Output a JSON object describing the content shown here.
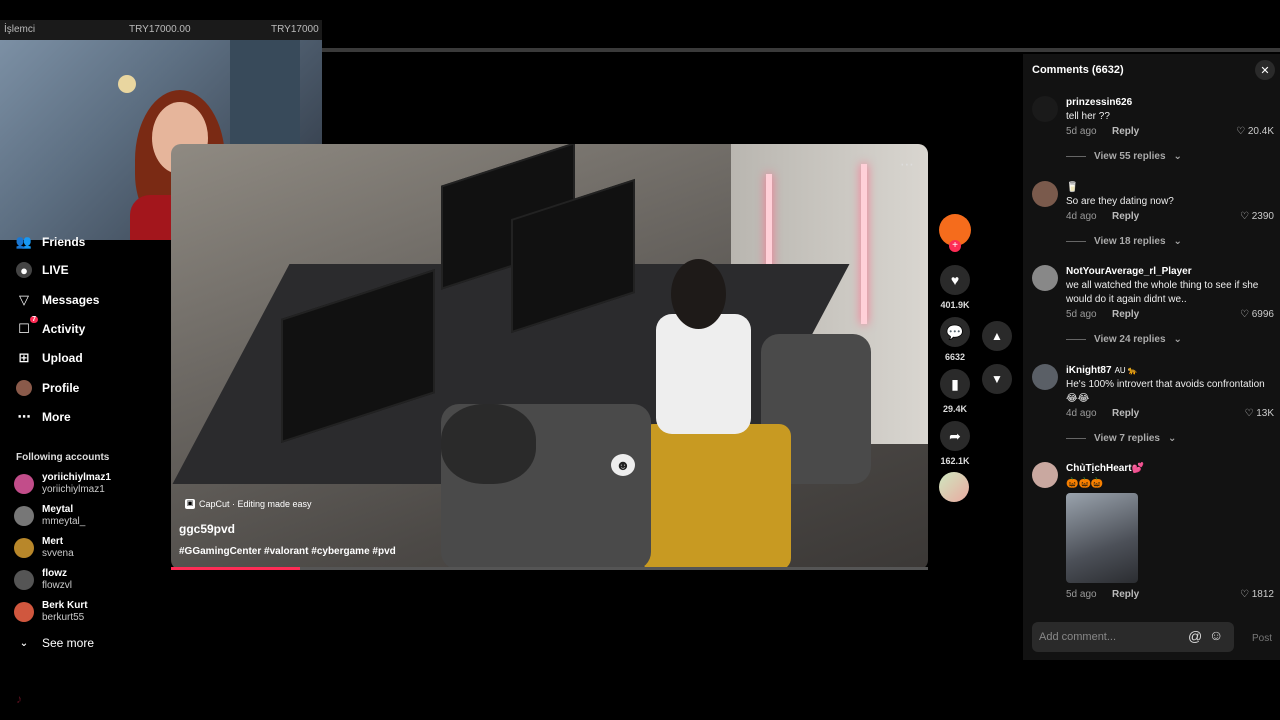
{
  "webcam": {
    "label_left": "İşlemci",
    "label_mid": "TRY17000.00",
    "label_right": "TRY17000"
  },
  "sidebar": {
    "items": [
      {
        "label": "Friends",
        "icon": "friends-icon"
      },
      {
        "label": "LIVE",
        "icon": "live-icon"
      },
      {
        "label": "Messages",
        "icon": "messages-icon"
      },
      {
        "label": "Activity",
        "icon": "activity-icon",
        "badge": "7"
      },
      {
        "label": "Upload",
        "icon": "upload-icon"
      },
      {
        "label": "Profile",
        "icon": "profile-icon"
      },
      {
        "label": "More",
        "icon": "more-icon"
      }
    ],
    "following_title": "Following accounts",
    "accounts": [
      {
        "name": "yoriichiylmaz1",
        "handle": "yoriichiylmaz1"
      },
      {
        "name": "Meytal",
        "handle": "mmeytal_"
      },
      {
        "name": "Mert",
        "handle": "svvena"
      },
      {
        "name": "flowz",
        "handle": "flowzvl"
      },
      {
        "name": "Berk Kurt",
        "handle": "berkurt55"
      }
    ],
    "see_more": "See more"
  },
  "video": {
    "capcut": "CapCut · Editing made easy",
    "author": "ggc59pvd",
    "caption": "#GGamingCenter #valorant #cybergame #pvd",
    "more_icon": "ellipsis-icon",
    "progress": 0.17
  },
  "rail": {
    "likes": "401.9K",
    "comments": "6632",
    "saves": "29.4K",
    "shares": "162.1K"
  },
  "comments": {
    "title": "Comments (6632)",
    "input_placeholder": "Add comment...",
    "post_label": "Post",
    "items": [
      {
        "user": "prinzessin626",
        "text": "tell her ??",
        "time": "5d ago",
        "reply": "Reply",
        "likes": "20.4K",
        "view_replies": "View 55 replies"
      },
      {
        "user": "🥛",
        "text": "So are they dating now?",
        "time": "4d ago",
        "reply": "Reply",
        "likes": "2390",
        "view_replies": "View 18 replies"
      },
      {
        "user": "NotYourAverage_rl_Player",
        "text": "we all watched the whole thing to see if she would do it again didnt we..",
        "time": "5d ago",
        "reply": "Reply",
        "likes": "6996",
        "view_replies": "View 24 replies"
      },
      {
        "user": "iKnight87",
        "user_suffix": "AU 🐆",
        "text": "He's 100% introvert that avoids confrontation 😂😂",
        "time": "4d ago",
        "reply": "Reply",
        "likes": "13K",
        "view_replies": "View 7 replies"
      },
      {
        "user": "ChủTịchHeart💕",
        "text": "🎃🎃🎃",
        "time": "5d ago",
        "reply": "Reply",
        "likes": "1812"
      }
    ]
  },
  "colors": {
    "accent": "#fe2c55",
    "panel_bg": "#121212"
  }
}
